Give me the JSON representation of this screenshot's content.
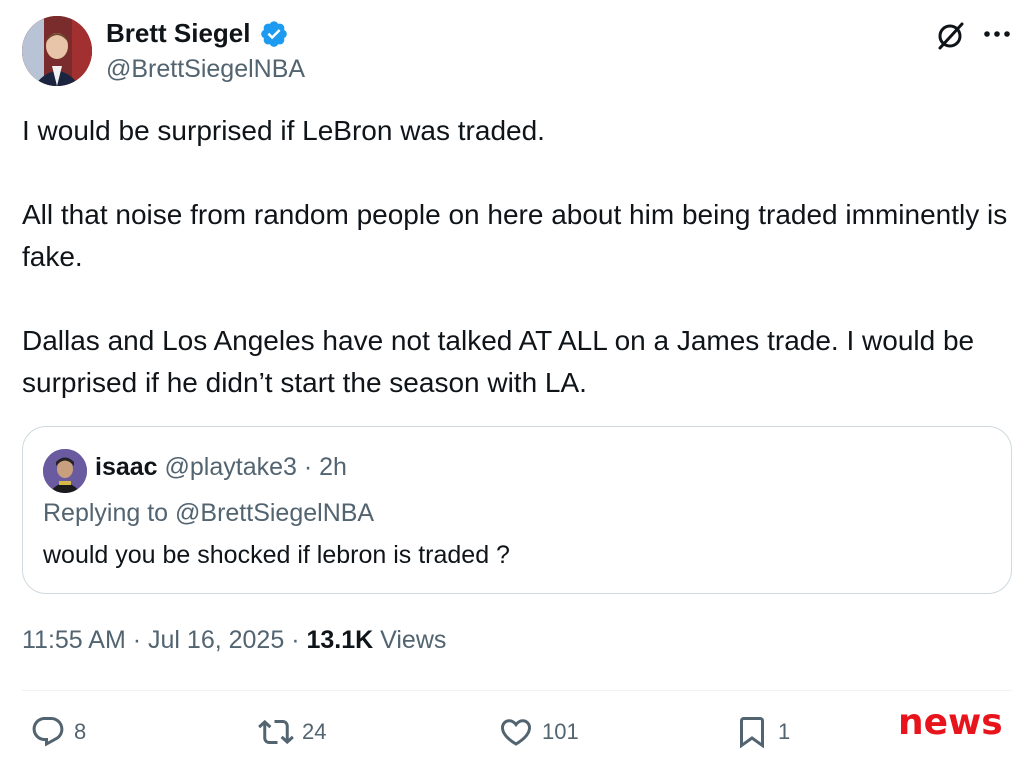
{
  "author": {
    "display_name": "Brett Siegel",
    "handle": "@BrettSiegelNBA",
    "verified": true,
    "avatar_icon": "person-portrait"
  },
  "header_icons": {
    "grok": "grok-icon",
    "more": "more-icon"
  },
  "tweet": {
    "paragraphs": [
      "I would be surprised if LeBron was traded.",
      "All that noise from random people on here about him being traded imminently is fake.",
      "Dallas and Los Angeles have not talked AT ALL on a James trade. I would be surprised if he didn’t start the season with LA."
    ]
  },
  "quote": {
    "name": "isaac",
    "handle": "@playtake3",
    "separator": "·",
    "time": "2h",
    "reply_line": "Replying to @BrettSiegelNBA",
    "text": "would you be shocked if lebron is traded ?"
  },
  "meta": {
    "time": "11:55 AM",
    "separator": "·",
    "date": "Jul 16, 2025",
    "views_count": "13.1K",
    "views_label": "Views"
  },
  "actions": {
    "replies": "8",
    "reposts": "24",
    "likes": "101",
    "bookmarks": "1"
  },
  "watermark": "news",
  "colors": {
    "verified_blue": "#1d9bf0",
    "secondary_text": "#536471",
    "primary_text": "#0f1419",
    "border": "#cfd9de",
    "watermark_red": "#e8141c"
  }
}
